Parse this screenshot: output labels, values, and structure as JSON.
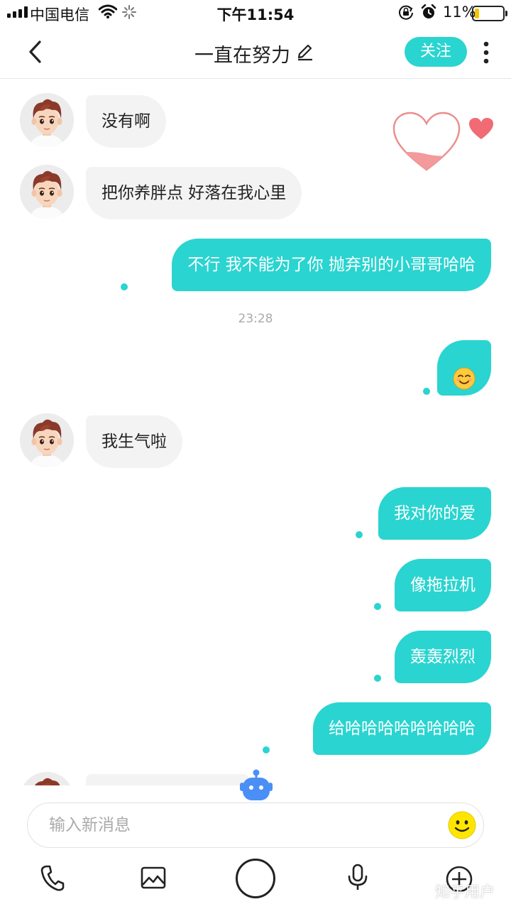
{
  "status_bar": {
    "carrier": "中国电信",
    "time": "下午11:54",
    "battery": "11%",
    "icons": [
      "signal-icon",
      "wifi-icon",
      "loading-icon",
      "orientation-lock-icon",
      "alarm-icon",
      "battery-icon"
    ]
  },
  "header": {
    "title": "一直在努力",
    "follow_label": "关注",
    "icons": [
      "back-icon",
      "edit-icon",
      "more-icon"
    ]
  },
  "messages": [
    {
      "from": "them",
      "text": "没有啊"
    },
    {
      "from": "them",
      "text": "把你养胖点  好落在我心里"
    },
    {
      "from": "me",
      "text": "不行 我不能为了你 抛弃别的小哥哥哈哈"
    },
    {
      "timestamp": "23:28"
    },
    {
      "from": "me",
      "icon": "smiley-emoji"
    },
    {
      "from": "them",
      "text": "我生气啦"
    },
    {
      "from": "me",
      "text": "我对你的爱"
    },
    {
      "from": "me",
      "text": "像拖拉机"
    },
    {
      "from": "me",
      "text": "轰轰烈烈"
    },
    {
      "from": "me",
      "text": "给哈哈哈哈哈哈哈哈"
    }
  ],
  "decorations": [
    "heart-meter-icon",
    "heart-icon",
    "robot-icon"
  ],
  "input": {
    "placeholder": "输入新消息",
    "value": ""
  },
  "toolbar": [
    "phone-icon",
    "image-icon",
    "record-button",
    "microphone-icon",
    "plus-icon"
  ],
  "watermark": "知乎用户",
  "colors": {
    "accent": "#2ad4d0",
    "incoming_bubble": "#f3f3f3",
    "heart": "#f06b73"
  }
}
